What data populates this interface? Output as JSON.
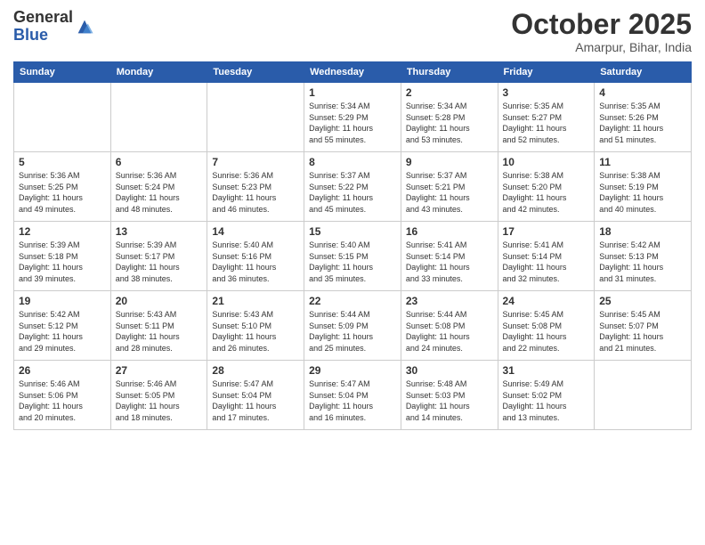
{
  "header": {
    "logo_line1": "General",
    "logo_line2": "Blue",
    "month": "October 2025",
    "location": "Amarpur, Bihar, India"
  },
  "weekdays": [
    "Sunday",
    "Monday",
    "Tuesday",
    "Wednesday",
    "Thursday",
    "Friday",
    "Saturday"
  ],
  "weeks": [
    [
      {
        "day": "",
        "info": ""
      },
      {
        "day": "",
        "info": ""
      },
      {
        "day": "",
        "info": ""
      },
      {
        "day": "1",
        "info": "Sunrise: 5:34 AM\nSunset: 5:29 PM\nDaylight: 11 hours\nand 55 minutes."
      },
      {
        "day": "2",
        "info": "Sunrise: 5:34 AM\nSunset: 5:28 PM\nDaylight: 11 hours\nand 53 minutes."
      },
      {
        "day": "3",
        "info": "Sunrise: 5:35 AM\nSunset: 5:27 PM\nDaylight: 11 hours\nand 52 minutes."
      },
      {
        "day": "4",
        "info": "Sunrise: 5:35 AM\nSunset: 5:26 PM\nDaylight: 11 hours\nand 51 minutes."
      }
    ],
    [
      {
        "day": "5",
        "info": "Sunrise: 5:36 AM\nSunset: 5:25 PM\nDaylight: 11 hours\nand 49 minutes."
      },
      {
        "day": "6",
        "info": "Sunrise: 5:36 AM\nSunset: 5:24 PM\nDaylight: 11 hours\nand 48 minutes."
      },
      {
        "day": "7",
        "info": "Sunrise: 5:36 AM\nSunset: 5:23 PM\nDaylight: 11 hours\nand 46 minutes."
      },
      {
        "day": "8",
        "info": "Sunrise: 5:37 AM\nSunset: 5:22 PM\nDaylight: 11 hours\nand 45 minutes."
      },
      {
        "day": "9",
        "info": "Sunrise: 5:37 AM\nSunset: 5:21 PM\nDaylight: 11 hours\nand 43 minutes."
      },
      {
        "day": "10",
        "info": "Sunrise: 5:38 AM\nSunset: 5:20 PM\nDaylight: 11 hours\nand 42 minutes."
      },
      {
        "day": "11",
        "info": "Sunrise: 5:38 AM\nSunset: 5:19 PM\nDaylight: 11 hours\nand 40 minutes."
      }
    ],
    [
      {
        "day": "12",
        "info": "Sunrise: 5:39 AM\nSunset: 5:18 PM\nDaylight: 11 hours\nand 39 minutes."
      },
      {
        "day": "13",
        "info": "Sunrise: 5:39 AM\nSunset: 5:17 PM\nDaylight: 11 hours\nand 38 minutes."
      },
      {
        "day": "14",
        "info": "Sunrise: 5:40 AM\nSunset: 5:16 PM\nDaylight: 11 hours\nand 36 minutes."
      },
      {
        "day": "15",
        "info": "Sunrise: 5:40 AM\nSunset: 5:15 PM\nDaylight: 11 hours\nand 35 minutes."
      },
      {
        "day": "16",
        "info": "Sunrise: 5:41 AM\nSunset: 5:14 PM\nDaylight: 11 hours\nand 33 minutes."
      },
      {
        "day": "17",
        "info": "Sunrise: 5:41 AM\nSunset: 5:14 PM\nDaylight: 11 hours\nand 32 minutes."
      },
      {
        "day": "18",
        "info": "Sunrise: 5:42 AM\nSunset: 5:13 PM\nDaylight: 11 hours\nand 31 minutes."
      }
    ],
    [
      {
        "day": "19",
        "info": "Sunrise: 5:42 AM\nSunset: 5:12 PM\nDaylight: 11 hours\nand 29 minutes."
      },
      {
        "day": "20",
        "info": "Sunrise: 5:43 AM\nSunset: 5:11 PM\nDaylight: 11 hours\nand 28 minutes."
      },
      {
        "day": "21",
        "info": "Sunrise: 5:43 AM\nSunset: 5:10 PM\nDaylight: 11 hours\nand 26 minutes."
      },
      {
        "day": "22",
        "info": "Sunrise: 5:44 AM\nSunset: 5:09 PM\nDaylight: 11 hours\nand 25 minutes."
      },
      {
        "day": "23",
        "info": "Sunrise: 5:44 AM\nSunset: 5:08 PM\nDaylight: 11 hours\nand 24 minutes."
      },
      {
        "day": "24",
        "info": "Sunrise: 5:45 AM\nSunset: 5:08 PM\nDaylight: 11 hours\nand 22 minutes."
      },
      {
        "day": "25",
        "info": "Sunrise: 5:45 AM\nSunset: 5:07 PM\nDaylight: 11 hours\nand 21 minutes."
      }
    ],
    [
      {
        "day": "26",
        "info": "Sunrise: 5:46 AM\nSunset: 5:06 PM\nDaylight: 11 hours\nand 20 minutes."
      },
      {
        "day": "27",
        "info": "Sunrise: 5:46 AM\nSunset: 5:05 PM\nDaylight: 11 hours\nand 18 minutes."
      },
      {
        "day": "28",
        "info": "Sunrise: 5:47 AM\nSunset: 5:04 PM\nDaylight: 11 hours\nand 17 minutes."
      },
      {
        "day": "29",
        "info": "Sunrise: 5:47 AM\nSunset: 5:04 PM\nDaylight: 11 hours\nand 16 minutes."
      },
      {
        "day": "30",
        "info": "Sunrise: 5:48 AM\nSunset: 5:03 PM\nDaylight: 11 hours\nand 14 minutes."
      },
      {
        "day": "31",
        "info": "Sunrise: 5:49 AM\nSunset: 5:02 PM\nDaylight: 11 hours\nand 13 minutes."
      },
      {
        "day": "",
        "info": ""
      }
    ]
  ]
}
